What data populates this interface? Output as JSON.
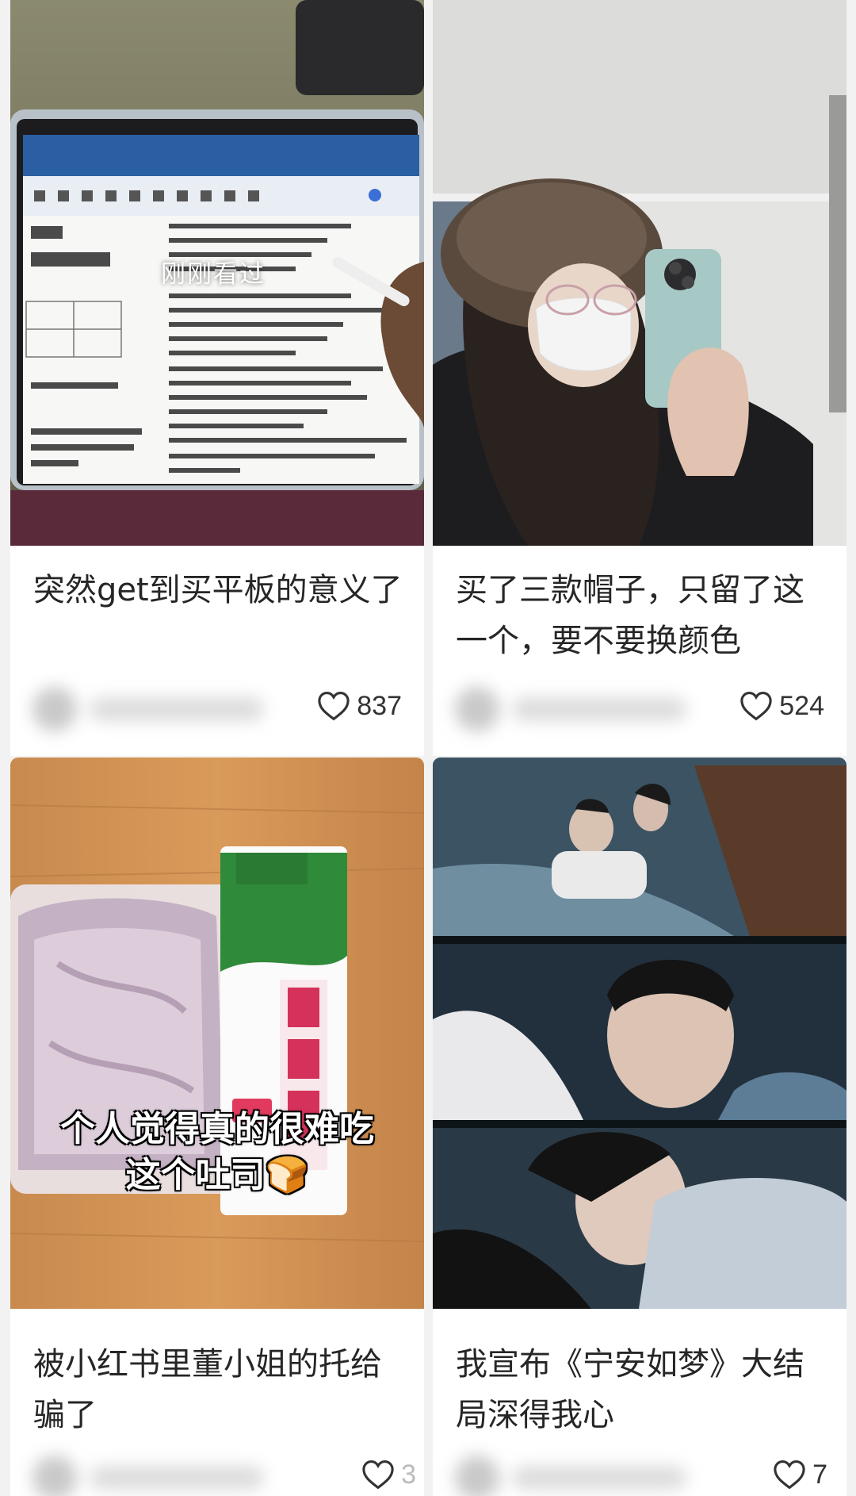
{
  "feed": {
    "cards": [
      {
        "title": "突然get到买平板的意义了",
        "likes": "837",
        "cover_overlay": "刚刚看过",
        "like_icon": "heart-outline-icon"
      },
      {
        "title": "买了三款帽子，只留了这一个，要不要换颜色",
        "likes": "524",
        "like_icon": "heart-outline-icon"
      },
      {
        "title": "被小红书里董小姐的托给骗了",
        "likes": "3",
        "cover_caption_line1": "个人觉得真的很难吃",
        "cover_caption_line2": "这个吐司🍞",
        "like_icon": "heart-outline-icon"
      },
      {
        "title": "我宣布《宁安如梦》大结局深得我心",
        "likes": "7",
        "like_icon": "heart-outline-icon"
      }
    ],
    "colors": {
      "page_bg": "#f2f2f2",
      "card_bg": "#ffffff",
      "text": "#262626"
    }
  }
}
